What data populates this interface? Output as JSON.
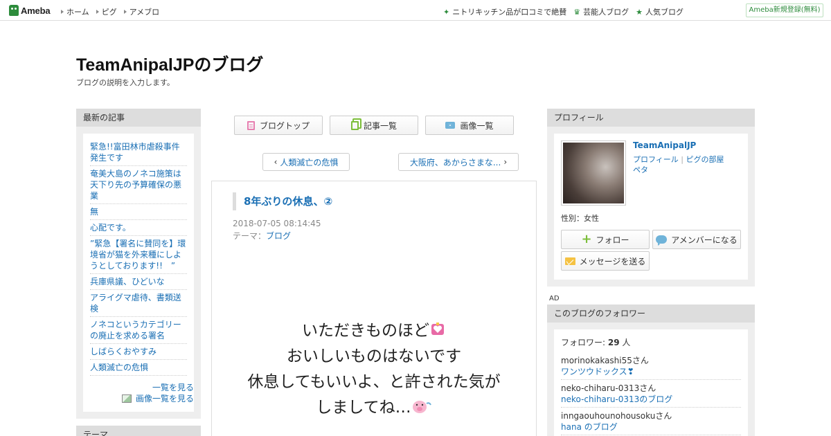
{
  "header": {
    "logo_text": "Ameba",
    "nav": [
      "ホーム",
      "ピグ",
      "アメブロ"
    ],
    "links": [
      {
        "label": "ニトリキッチン品が口コミで絶賛",
        "icon": "sparkle-icon"
      },
      {
        "label": "芸能人ブログ",
        "icon": "crown-icon"
      },
      {
        "label": "人気ブログ",
        "icon": "star-icon"
      }
    ],
    "register_label": "Ameba新規登録(無料)"
  },
  "blog": {
    "title": "TeamAnipalJPのブログ",
    "description": "ブログの説明を入力します。"
  },
  "recent": {
    "heading": "最新の記事",
    "items": [
      "緊急!!富田林市虐殺事件発生です",
      "奄美大島のノネコ施策は天下り先の予算確保の悪業",
      "無",
      "心配です。",
      "”緊急【署名に賛同を】環境省が猫を外来種にしようとしております!!　”",
      "兵庫県議、ひどいな",
      "アライグマ虐待、書類送検",
      "ノネコというカテゴリーの廃止を求める署名",
      "しばらくおやすみ",
      "人類滅亡の危惧"
    ],
    "see_all": "一覧を見る",
    "see_images": "画像一覧を見る"
  },
  "theme_box": {
    "heading": "テーマ"
  },
  "center_nav": {
    "top": "ブログトップ",
    "list": "記事一覧",
    "images": "画像一覧"
  },
  "pager": {
    "prev": "人類滅亡の危惧",
    "next": "大阪府、あからさまな..."
  },
  "article": {
    "title": "8年ぶりの休息、②",
    "date": "2018-07-05 08:14:45",
    "theme_label": "テーマ：",
    "theme_value": "ブログ",
    "body": [
      "いただきものほど",
      "おいしいものはないです",
      "休息してもいいよ、と許された気が",
      "しましてね…"
    ]
  },
  "profile": {
    "heading": "プロフィール",
    "name": "TeamAnipalJP",
    "link_profile": "プロフィール",
    "link_pig": "ピグの部屋",
    "link_peta": "ペタ",
    "gender": "性別：女性",
    "follow": "フォロー",
    "amember": "アメンバーになる",
    "message": "メッセージを送る"
  },
  "ad_label": "AD",
  "followers": {
    "heading": "このブログのフォロワー",
    "count_label": "フォロワー:",
    "count": "29",
    "count_unit": "人",
    "items": [
      {
        "name": "morinokakashi55さん",
        "blog": "ワンツウドックス❣"
      },
      {
        "name": "neko-chiharu-0313さん",
        "blog": "neko-chiharu-0313のブログ"
      },
      {
        "name": "inngaouhounohousokuさん",
        "blog": "hana のブログ"
      }
    ]
  }
}
